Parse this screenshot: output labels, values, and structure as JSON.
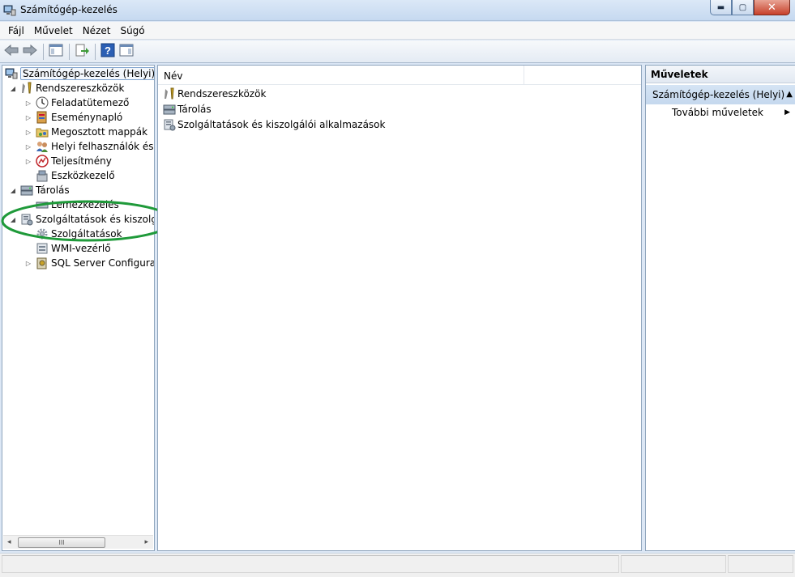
{
  "window": {
    "title": "Számítógép-kezelés",
    "icon": "computer-management-icon",
    "minimize_glyph": "▬",
    "maximize_glyph": "▢",
    "close_glyph": "✕"
  },
  "menu": [
    "Fájl",
    "Művelet",
    "Nézet",
    "Súgó"
  ],
  "toolbar": [
    "back-icon",
    "forward-icon",
    "show-hide-tree-icon",
    "export-list-icon",
    "help-icon",
    "show-hide-action-pane-icon"
  ],
  "tree": {
    "root": "Számítógép-kezelés (Helyi)",
    "items": [
      {
        "label": "Rendszereszközök",
        "icon": "tools-icon",
        "expander": "◢"
      },
      {
        "label": "Feladatütemező",
        "icon": "clock-icon",
        "expander": "▷"
      },
      {
        "label": "Eseménynapló",
        "icon": "event-viewer-icon",
        "expander": "▷"
      },
      {
        "label": "Megosztott mappák",
        "icon": "shared-folder-icon",
        "expander": "▷"
      },
      {
        "label": "Helyi felhasználók és cs",
        "icon": "users-icon",
        "expander": "▷"
      },
      {
        "label": "Teljesítmény",
        "icon": "performance-icon",
        "expander": "▷"
      },
      {
        "label": "Eszközkezelő",
        "icon": "device-manager-icon",
        "expander": ""
      },
      {
        "label": "Tárolás",
        "icon": "storage-icon",
        "expander": "◢"
      },
      {
        "label": "Lemezkezelés",
        "icon": "disk-icon",
        "expander": ""
      },
      {
        "label": "Szolgáltatások és kiszolgáló",
        "icon": "services-apps-icon",
        "expander": "◢"
      },
      {
        "label": "Szolgáltatások",
        "icon": "gear-icon",
        "expander": ""
      },
      {
        "label": "WMI-vezérlő",
        "icon": "wmi-icon",
        "expander": ""
      },
      {
        "label": "SQL Server Configuratic",
        "icon": "sql-server-icon",
        "expander": "▷"
      }
    ],
    "scroll_thumb_text": "III",
    "scroll_left": "◂",
    "scroll_right": "▸"
  },
  "list": {
    "column_name": "Név",
    "rows": [
      {
        "label": "Rendszereszközök",
        "icon": "tools-icon"
      },
      {
        "label": "Tárolás",
        "icon": "storage-icon"
      },
      {
        "label": "Szolgáltatások és kiszolgálói alkalmazások",
        "icon": "services-apps-icon"
      }
    ]
  },
  "actions": {
    "title": "Műveletek",
    "section": "Számítógép-kezelés (Helyi)",
    "section_toggle": "▲",
    "items": [
      {
        "label": "További műveletek",
        "arrow": "▶"
      }
    ]
  },
  "colors": {
    "annotation": "#1f9a3a",
    "selection_border": "#7da2ce",
    "actions_header": "#c5d8ee"
  }
}
